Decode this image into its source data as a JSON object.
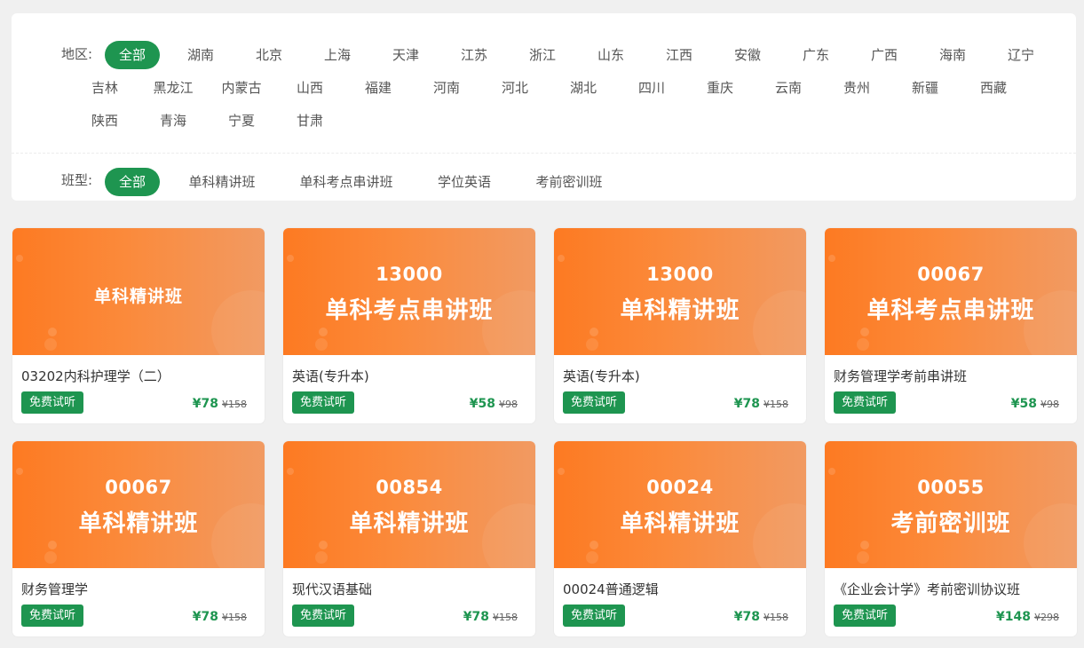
{
  "filters": {
    "region": {
      "label": "地区:",
      "options": [
        "全部",
        "湖南",
        "北京",
        "上海",
        "天津",
        "江苏",
        "浙江",
        "山东",
        "江西",
        "安徽",
        "广东",
        "广西",
        "海南",
        "辽宁",
        "吉林",
        "黑龙江",
        "内蒙古",
        "山西",
        "福建",
        "河南",
        "河北",
        "湖北",
        "四川",
        "重庆",
        "云南",
        "贵州",
        "新疆",
        "西藏",
        "陕西",
        "青海",
        "宁夏",
        "甘肃"
      ],
      "selected": "全部"
    },
    "class_type": {
      "label": "班型:",
      "options": [
        "全部",
        "单科精讲班",
        "单科考点串讲班",
        "学位英语",
        "考前密训班"
      ],
      "selected": "全部"
    }
  },
  "courses": [
    {
      "code": "",
      "class_title": "单科精讲班",
      "name": "03202内科护理学（二）",
      "trial_label": "免费试听",
      "price": "¥78",
      "original_price": "¥158"
    },
    {
      "code": "13000",
      "class_title": "单科考点串讲班",
      "name": "英语(专升本)",
      "trial_label": "免费试听",
      "price": "¥58",
      "original_price": "¥98"
    },
    {
      "code": "13000",
      "class_title": "单科精讲班",
      "name": "英语(专升本)",
      "trial_label": "免费试听",
      "price": "¥78",
      "original_price": "¥158"
    },
    {
      "code": "00067",
      "class_title": "单科考点串讲班",
      "name": "财务管理学考前串讲班",
      "trial_label": "免费试听",
      "price": "¥58",
      "original_price": "¥98"
    },
    {
      "code": "00067",
      "class_title": "单科精讲班",
      "name": "财务管理学",
      "trial_label": "免费试听",
      "price": "¥78",
      "original_price": "¥158"
    },
    {
      "code": "00854",
      "class_title": "单科精讲班",
      "name": "现代汉语基础",
      "trial_label": "免费试听",
      "price": "¥78",
      "original_price": "¥158"
    },
    {
      "code": "00024",
      "class_title": "单科精讲班",
      "name": "00024普通逻辑",
      "trial_label": "免费试听",
      "price": "¥78",
      "original_price": "¥158"
    },
    {
      "code": "00055",
      "class_title": "考前密训班",
      "name": "《企业会计学》考前密训协议班",
      "trial_label": "免费试听",
      "price": "¥148",
      "original_price": "¥298"
    }
  ],
  "colors": {
    "accent_green": "#1e9550",
    "banner_orange": "#fd7a22"
  }
}
